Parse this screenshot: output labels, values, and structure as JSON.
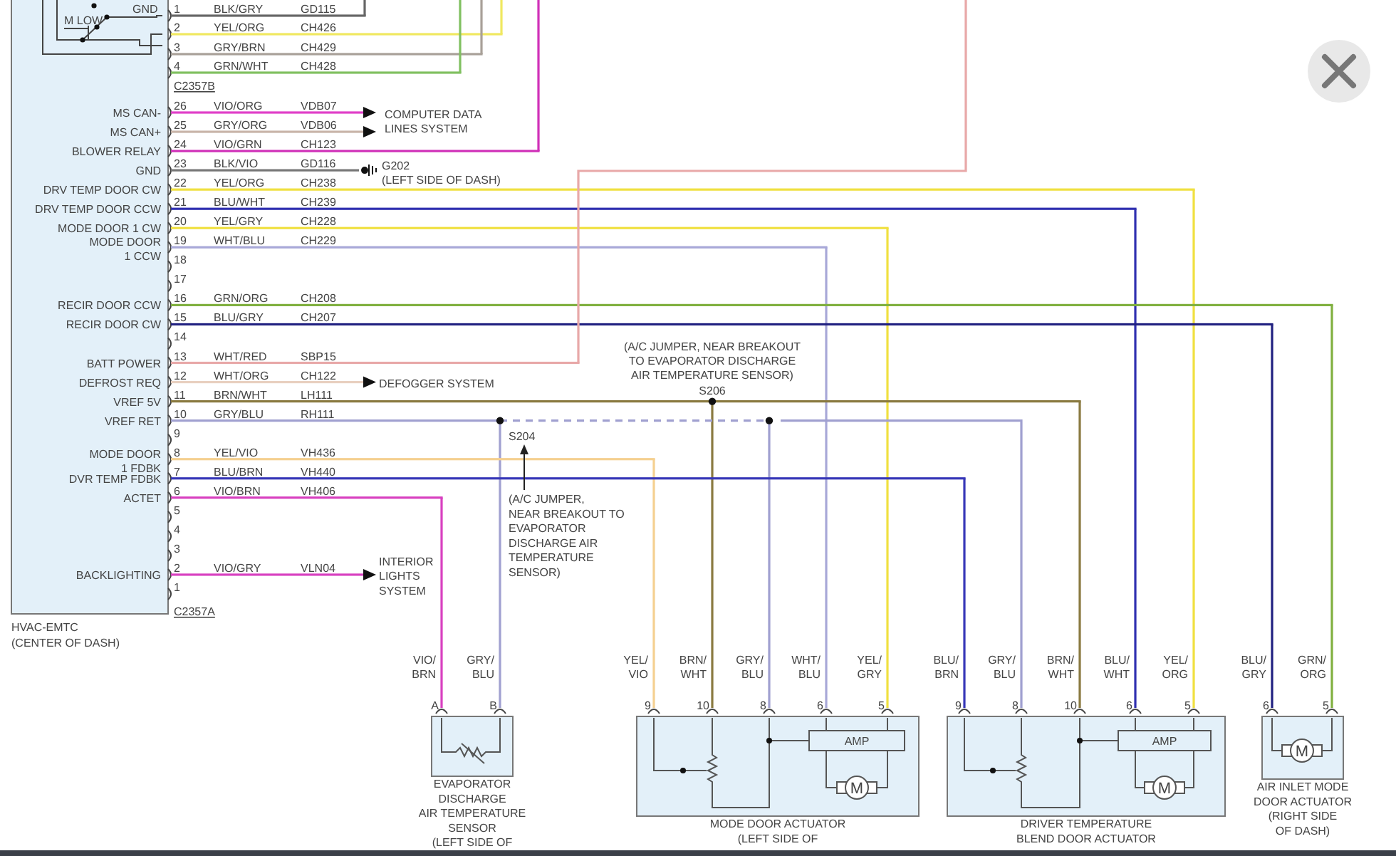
{
  "module": {
    "name": "HVAC-EMTC",
    "location": "(CENTER OF DASH)"
  },
  "switch": {
    "labels": [
      "M LOW",
      "GND"
    ]
  },
  "connector_b": {
    "name": "C2357B",
    "pins": [
      {
        "number": "1",
        "wire": "BLK/GRY",
        "circuit": "GD115",
        "color": "#666666"
      },
      {
        "number": "2",
        "wire": "YEL/ORG",
        "circuit": "CH426",
        "color": "#f0e860"
      },
      {
        "number": "3",
        "wire": "GRY/BRN",
        "circuit": "CH429",
        "color": "#a8a098"
      },
      {
        "number": "4",
        "wire": "GRN/WHT",
        "circuit": "CH428",
        "color": "#80c060"
      }
    ]
  },
  "connector_a": {
    "name": "C2357A",
    "pins": [
      {
        "number": "26",
        "label": [
          "MS CAN-"
        ],
        "wire": "VIO/ORG",
        "circuit": "VDB07",
        "color": "#e040c8"
      },
      {
        "number": "25",
        "label": [
          "MS CAN+"
        ],
        "wire": "GRY/ORG",
        "circuit": "VDB06",
        "color": "#c8b4a8"
      },
      {
        "number": "24",
        "label": [
          "BLOWER RELAY"
        ],
        "wire": "VIO/GRN",
        "circuit": "CH123",
        "color": "#d030b8"
      },
      {
        "number": "23",
        "label": [
          "GND"
        ],
        "wire": "BLK/VIO",
        "circuit": "GD116",
        "color": "#777777"
      },
      {
        "number": "22",
        "label": [
          "DRV TEMP DOOR CW"
        ],
        "wire": "YEL/ORG",
        "circuit": "CH238",
        "color": "#f0e040"
      },
      {
        "number": "21",
        "label": [
          "DRV TEMP DOOR CCW"
        ],
        "wire": "BLU/WHT",
        "circuit": "CH239",
        "color": "#3030b0"
      },
      {
        "number": "20",
        "label": [
          "MODE DOOR 1 CW"
        ],
        "wire": "YEL/GRY",
        "circuit": "CH228",
        "color": "#f0e040"
      },
      {
        "number": "19",
        "label": [
          "MODE DOOR",
          "1 CCW"
        ],
        "wire": "WHT/BLU",
        "circuit": "CH229",
        "color": "#a8a8d8"
      },
      {
        "number": "18"
      },
      {
        "number": "17"
      },
      {
        "number": "16",
        "label": [
          "RECIR DOOR CCW"
        ],
        "wire": "GRN/ORG",
        "circuit": "CH208",
        "color": "#80b040"
      },
      {
        "number": "15",
        "label": [
          "RECIR DOOR CW"
        ],
        "wire": "BLU/GRY",
        "circuit": "CH207",
        "color": "#202080"
      },
      {
        "number": "14"
      },
      {
        "number": "13",
        "label": [
          "BATT POWER"
        ],
        "wire": "WHT/RED",
        "circuit": "SBP15",
        "color": "#e8a8a8"
      },
      {
        "number": "12",
        "label": [
          "DEFROST REQ"
        ],
        "wire": "WHT/ORG",
        "circuit": "CH122",
        "color": "#e8d0c0"
      },
      {
        "number": "11",
        "label": [
          "VREF 5V"
        ],
        "wire": "BRN/WHT",
        "circuit": "LH111",
        "color": "#8a7a40"
      },
      {
        "number": "10",
        "label": [
          "VREF RET"
        ],
        "wire": "GRY/BLU",
        "circuit": "RH111",
        "color": "#a0a0d0"
      },
      {
        "number": "9"
      },
      {
        "number": "8",
        "label": [
          "MODE DOOR",
          "1 FDBK"
        ],
        "wire": "YEL/VIO",
        "circuit": "VH436",
        "color": "#f5d090"
      },
      {
        "number": "7",
        "label": [
          "DVR TEMP FDBK"
        ],
        "wire": "BLU/BRN",
        "circuit": "VH440",
        "color": "#3838b8"
      },
      {
        "number": "6",
        "label": [
          "ACTET"
        ],
        "wire": "VIO/BRN",
        "circuit": "VH406",
        "color": "#d840c0"
      },
      {
        "number": "5"
      },
      {
        "number": "4"
      },
      {
        "number": "3"
      },
      {
        "number": "2",
        "label": [
          "BACKLIGHTING"
        ],
        "wire": "VIO/GRY",
        "circuit": "VLN04",
        "color": "#d840c0"
      },
      {
        "number": "1"
      }
    ]
  },
  "destinations": [
    {
      "kind": "arrow",
      "lines": [
        "COMPUTER DATA",
        "LINES SYSTEM"
      ]
    },
    {
      "kind": "ground",
      "lines": [
        "G202",
        "(LEFT SIDE OF DASH)"
      ]
    },
    {
      "kind": "arrow",
      "lines": [
        "DEFOGGER SYSTEM"
      ]
    },
    {
      "kind": "arrow",
      "lines": [
        "INTERIOR",
        "LIGHTS",
        "SYSTEM"
      ]
    }
  ],
  "splices": [
    {
      "name": "S206",
      "note": [
        "(A/C JUMPER, NEAR BREAKOUT",
        "TO EVAPORATOR DISCHARGE",
        "AIR TEMPERATURE SENSOR)"
      ]
    },
    {
      "name": "S204",
      "note": [
        "(A/C JUMPER,",
        "NEAR BREAKOUT TO",
        "EVAPORATOR",
        "DISCHARGE AIR",
        "TEMPERATURE",
        "SENSOR)"
      ]
    }
  ],
  "components": [
    {
      "kind": "sensor",
      "name": [
        "EVAPORATOR",
        "DISCHARGE",
        "AIR TEMPERATURE",
        "SENSOR",
        "(LEFT SIDE OF"
      ],
      "pins": [
        {
          "pin": "A",
          "wire": [
            "VIO/",
            "BRN"
          ]
        },
        {
          "pin": "B",
          "wire": [
            "GRY/",
            "BLU"
          ]
        }
      ]
    },
    {
      "kind": "actuator",
      "amp": "AMP",
      "motor": "M",
      "name": [
        "MODE DOOR ACTUATOR",
        "(LEFT SIDE OF"
      ],
      "pins": [
        {
          "pin": "9",
          "wire": [
            "YEL/",
            "VIO"
          ]
        },
        {
          "pin": "10",
          "wire": [
            "BRN/",
            "WHT"
          ]
        },
        {
          "pin": "8",
          "wire": [
            "GRY/",
            "BLU"
          ]
        },
        {
          "pin": "6",
          "wire": [
            "WHT/",
            "BLU"
          ]
        },
        {
          "pin": "5",
          "wire": [
            "YEL/",
            "GRY"
          ]
        }
      ]
    },
    {
      "kind": "actuator",
      "amp": "AMP",
      "motor": "M",
      "name": [
        "DRIVER TEMPERATURE",
        "BLEND DOOR ACTUATOR"
      ],
      "pins": [
        {
          "pin": "9",
          "wire": [
            "BLU/",
            "BRN"
          ]
        },
        {
          "pin": "8",
          "wire": [
            "GRY/",
            "BLU"
          ]
        },
        {
          "pin": "10",
          "wire": [
            "BRN/",
            "WHT"
          ]
        },
        {
          "pin": "6",
          "wire": [
            "BLU/",
            "WHT"
          ]
        },
        {
          "pin": "5",
          "wire": [
            "YEL/",
            "ORG"
          ]
        }
      ]
    },
    {
      "kind": "motor",
      "motor": "M",
      "name": [
        "AIR INLET MODE",
        "DOOR ACTUATOR",
        "(RIGHT SIDE",
        "OF DASH)"
      ],
      "pins": [
        {
          "pin": "6",
          "wire": [
            "BLU/",
            "GRY"
          ]
        },
        {
          "pin": "5",
          "wire": [
            "GRN/",
            "ORG"
          ]
        }
      ]
    }
  ]
}
